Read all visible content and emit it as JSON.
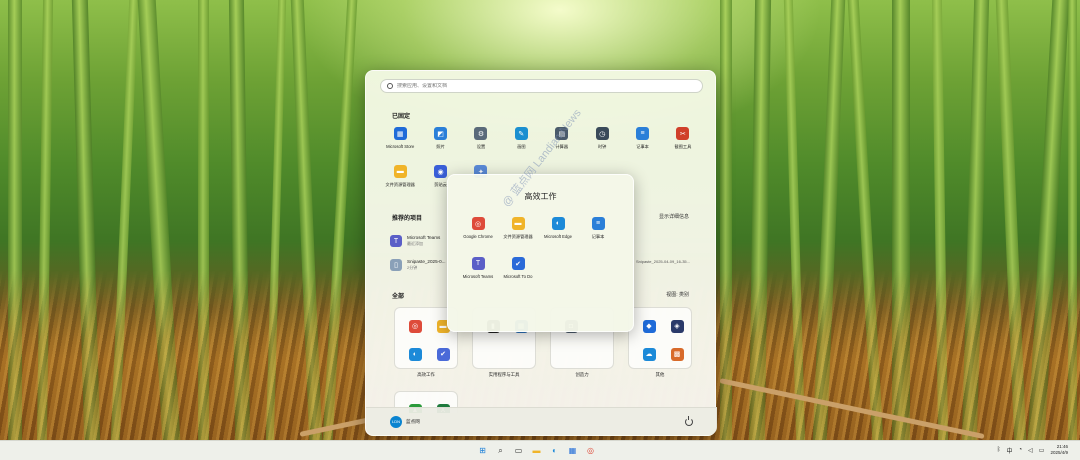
{
  "search": {
    "placeholder": "搜索应用、设置和文档"
  },
  "pinned": {
    "title": "已固定",
    "apps": [
      {
        "label": "Microsoft Store",
        "icon": "store-icon",
        "color": "#1f6bd8"
      },
      {
        "label": "照片",
        "icon": "photos-icon",
        "color": "#2a7fd8"
      },
      {
        "label": "设置",
        "icon": "gear-icon",
        "color": "#5a6a7a"
      },
      {
        "label": "画图",
        "icon": "paint-icon",
        "color": "#1b8fd0"
      },
      {
        "label": "计算器",
        "icon": "calculator-icon",
        "color": "#4a5a6a"
      },
      {
        "label": "时钟",
        "icon": "clock-icon",
        "color": "#3a4a5a"
      },
      {
        "label": "记事本",
        "icon": "notepad-icon",
        "color": "#2a7fd8"
      },
      {
        "label": "截图工具",
        "icon": "snipping-tool-icon",
        "color": "#d0402a"
      },
      {
        "label": "文件资源管理器",
        "icon": "folder-icon",
        "color": "#f0b429"
      },
      {
        "label": "剪贴云",
        "icon": "clipchamp-icon",
        "color": "#3a5fd8"
      },
      {
        "label": "",
        "icon": "copilot-icon",
        "color": "#5a8ad8"
      }
    ]
  },
  "recommended": {
    "title": "推荐的项目",
    "more": "显示详细信息",
    "items": [
      {
        "name": "Microsoft Teams",
        "sub": "最近添加",
        "icon": "teams-icon",
        "color": "#5b5fc7"
      },
      {
        "name": "Snipaste_2025-0...",
        "sub": "2分钟",
        "icon": "file-icon",
        "color": "#8aa0b8"
      }
    ],
    "right_item": "Snipaste_2025-04-09_16-35..."
  },
  "all": {
    "title": "全部",
    "view": "视图: 类别",
    "folders": [
      {
        "label": "高效工作",
        "icons": [
          {
            "icon": "chrome-icon",
            "color": "#de4b3a"
          },
          {
            "icon": "folder-icon",
            "color": "#f0b429"
          },
          {
            "icon": "edge-icon",
            "color": "#1c8ad8"
          },
          {
            "icon": "todo-icon",
            "color": "#4a6ad8"
          }
        ]
      },
      {
        "label": "实用程序与工具",
        "icons": [
          {
            "icon": "terminal-icon",
            "color": "#222222"
          },
          {
            "icon": "apps-icon",
            "color": "#2a6fb8"
          }
        ]
      },
      {
        "label": "创造力",
        "icons": [
          {
            "icon": "camera-icon",
            "color": "#4a5a6a"
          }
        ]
      },
      {
        "label": "其他",
        "icons": [
          {
            "icon": "defender-icon",
            "color": "#1f6bd8"
          },
          {
            "icon": "shield-icon",
            "color": "#2a3a6a"
          },
          {
            "icon": "onedrive-icon",
            "color": "#1c8ad8"
          },
          {
            "icon": "widgets-icon",
            "color": "#d86a2a"
          }
        ]
      }
    ],
    "partial_icons": [
      {
        "icon": "green-app-icon",
        "color": "#2a9a3a"
      },
      {
        "icon": "excel-icon",
        "color": "#1e7a3c"
      }
    ]
  },
  "footer": {
    "user_name": "蓝点网",
    "avatar_text": "LDN"
  },
  "popup": {
    "title": "高效工作",
    "apps": [
      {
        "label": "Google Chrome",
        "icon": "chrome-icon",
        "color": "#de4b3a"
      },
      {
        "label": "文件资源管理器",
        "icon": "folder-icon",
        "color": "#f0b429"
      },
      {
        "label": "Microsoft Edge",
        "icon": "edge-icon",
        "color": "#1c8ad8"
      },
      {
        "label": "记事本",
        "icon": "notepad-icon",
        "color": "#2a7fd8"
      },
      {
        "label": "Microsoft Teams",
        "icon": "teams-icon",
        "color": "#5b5fc7"
      },
      {
        "label": "Microsoft To Do",
        "icon": "todo-icon",
        "color": "#2a6ad8"
      }
    ]
  },
  "watermark": "@ 蓝点网 Landian.News",
  "taskbar": {
    "apps": [
      {
        "icon": "windows-start-icon",
        "color": "#1a7fd8"
      },
      {
        "icon": "search-icon",
        "color": "#333333"
      },
      {
        "icon": "task-view-icon",
        "color": "#333333"
      },
      {
        "icon": "folder-icon",
        "color": "#f0b429"
      },
      {
        "icon": "edge-icon",
        "color": "#1c8ad8"
      },
      {
        "icon": "store-icon",
        "color": "#1f6bd8"
      },
      {
        "icon": "chrome-icon",
        "color": "#de4b3a"
      }
    ],
    "ime": "中",
    "time": "21:46",
    "date": "2025/4/9"
  }
}
